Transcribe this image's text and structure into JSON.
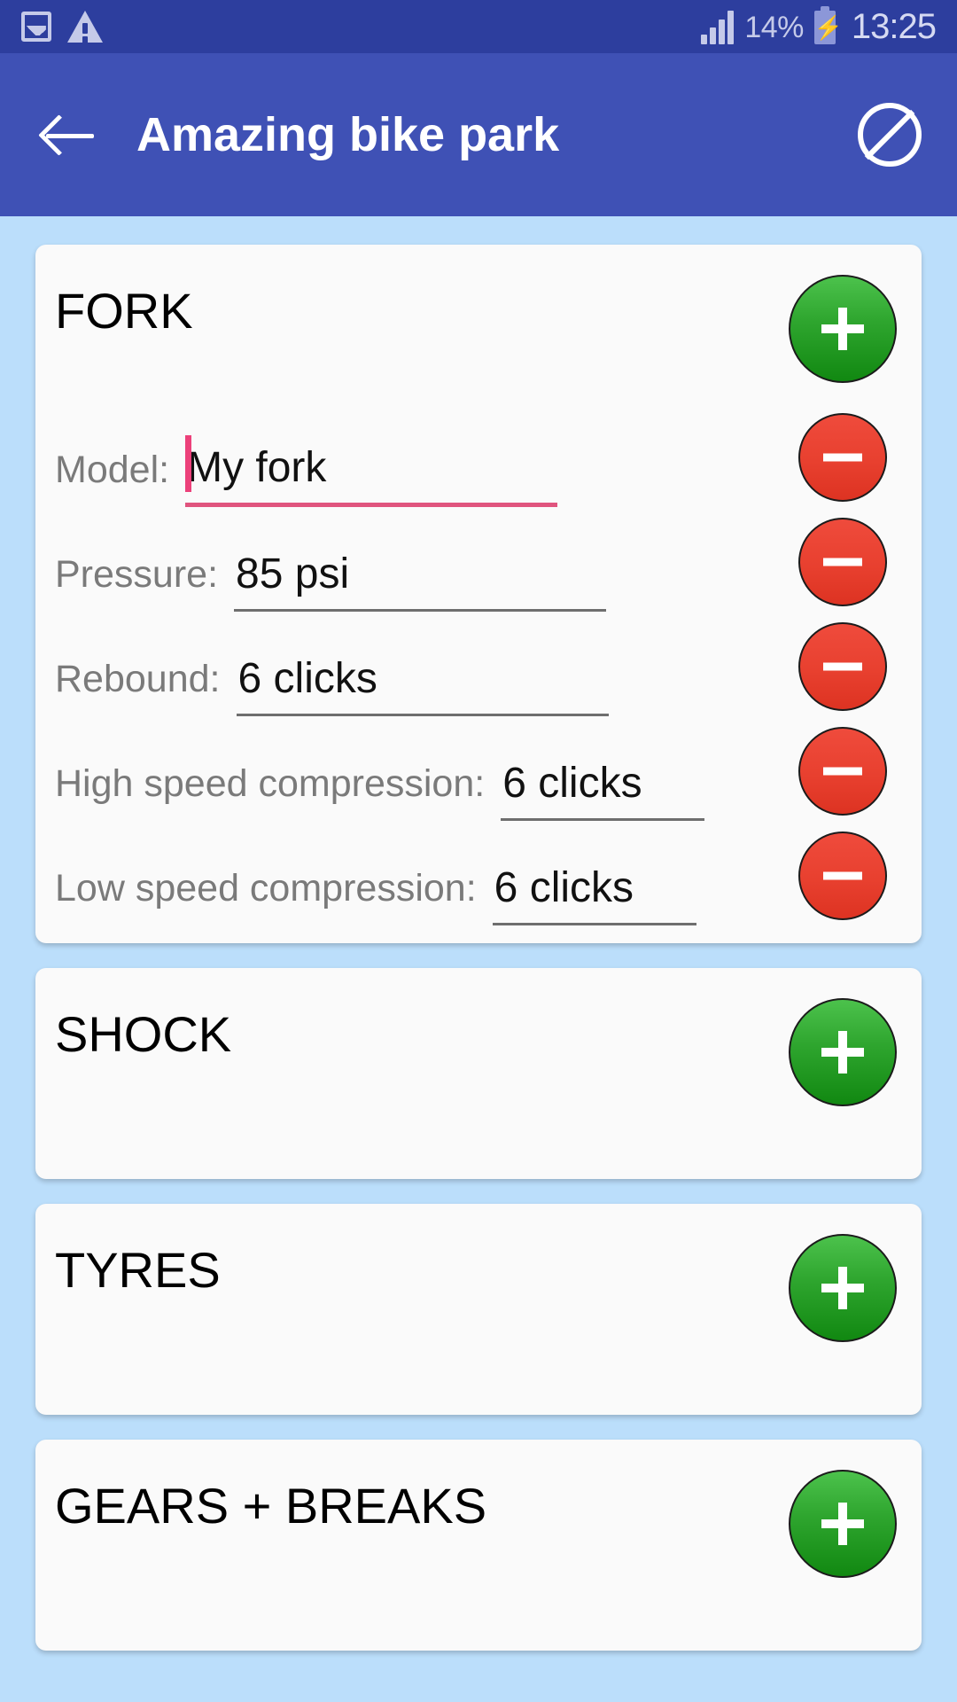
{
  "status_bar": {
    "icons_left": [
      "screenshot-icon",
      "warning-icon"
    ],
    "signal_icon": "signal-bars-icon",
    "battery_percent": "14%",
    "battery_icon": "battery-charging-icon",
    "clock": "13:25"
  },
  "toolbar": {
    "back_icon": "back-arrow-icon",
    "title": "Amazing bike park",
    "action_icon": "block-icon"
  },
  "cards": [
    {
      "title": "FORK",
      "add_label": "+",
      "expanded": true,
      "fields": [
        {
          "label": "Model:",
          "value": "My fork",
          "focused": true,
          "remove_label": "–",
          "layout": "normal"
        },
        {
          "label": "Pressure:",
          "value": "85 psi",
          "focused": false,
          "remove_label": "–",
          "layout": "normal"
        },
        {
          "label": "Rebound:",
          "value": "6 clicks",
          "focused": false,
          "remove_label": "–",
          "layout": "normal"
        },
        {
          "label": "High speed compression:",
          "value": "6 clicks",
          "focused": false,
          "remove_label": "–",
          "layout": "wide"
        },
        {
          "label": "Low speed compression:",
          "value": "6 clicks",
          "focused": false,
          "remove_label": "–",
          "layout": "wide"
        }
      ]
    },
    {
      "title": "SHOCK",
      "add_label": "+",
      "expanded": false,
      "fields": []
    },
    {
      "title": "TYRES",
      "add_label": "+",
      "expanded": false,
      "fields": []
    },
    {
      "title": "GEARS + BREAKS",
      "add_label": "+",
      "expanded": false,
      "fields": []
    }
  ],
  "colors": {
    "status_bar": "#2D3E9E",
    "toolbar": "#3F51B5",
    "background": "#BBDEFB",
    "card": "#FAFAFA",
    "add_button": "#2FA62F",
    "remove_button": "#E8402F",
    "focus_accent": "#EC407A",
    "label_text": "#7A7A7A"
  }
}
